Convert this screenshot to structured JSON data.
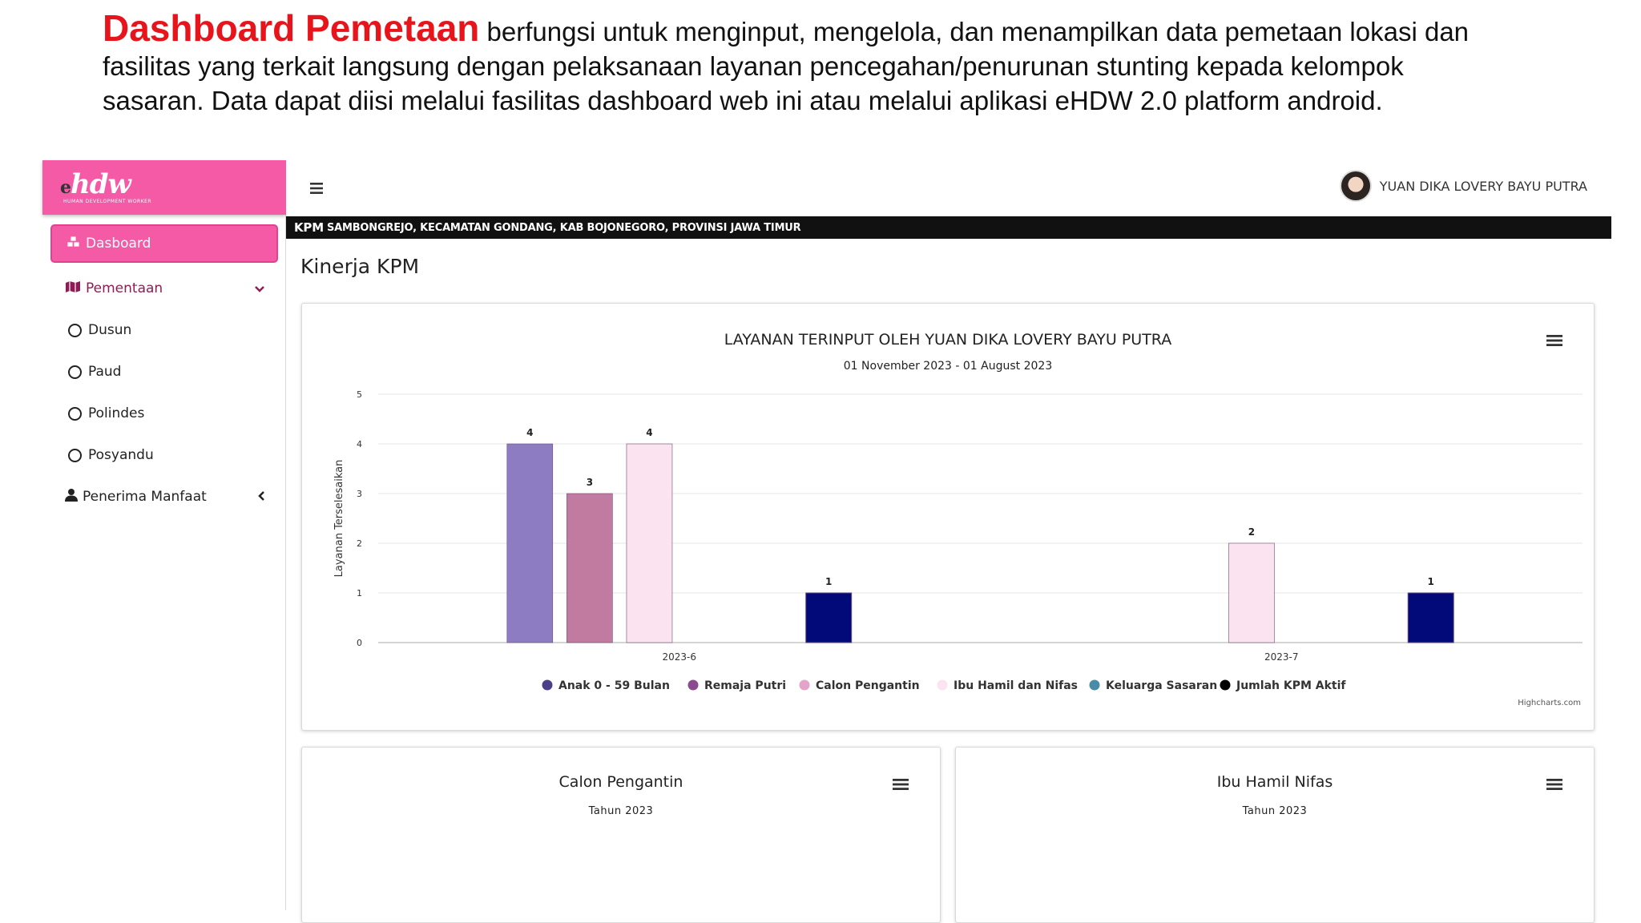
{
  "intro": {
    "highlight": "Dashboard Pemetaan",
    "line1": " berfungsi untuk menginput, mengelola, dan menampilkan data pemetaan lokasi dan",
    "line2": "fasilitas yang terkait langsung dengan pelaksanaan layanan pencegahan/penurunan stunting kepada kelompok",
    "line3": "sasaran. Data dapat diisi melalui fasilitas dashboard web ini atau melalui aplikasi eHDW 2.0 platform android."
  },
  "brand": {
    "logo_e": "e",
    "logo": "hdw",
    "tagline": "HUMAN DEVELOPMENT WORKER"
  },
  "sidebar": {
    "active": {
      "label": "Dasboard",
      "icon": "cubes-icon"
    },
    "items": [
      {
        "label": "Pementaan",
        "icon": "map-icon",
        "caret": "chevron-down-icon"
      },
      {
        "label": "Dusun",
        "icon": "circle-icon"
      },
      {
        "label": "Paud",
        "icon": "circle-icon"
      },
      {
        "label": "Polindes",
        "icon": "circle-icon"
      },
      {
        "label": "Posyandu",
        "icon": "circle-icon"
      },
      {
        "label": "Penerima Manfaat",
        "icon": "user-icon",
        "caret": "chevron-left-icon"
      }
    ]
  },
  "header": {
    "menu_icon": "hamburger-icon",
    "user_name": "YUAN DIKA LOVERY BAYU PUTRA"
  },
  "location": {
    "prefix": "KPM",
    "text": "SAMBONGREJO, KECAMATAN GONDANG, KAB BOJONEGORO, PROVINSI JAWA TIMUR"
  },
  "page": {
    "title": "Kinerja KPM"
  },
  "colors": {
    "brand": "#f45aa6",
    "anak": "#8e7cc3",
    "remaja": "#c27ba0",
    "calon": "#fbe0ee",
    "ibu": "#fde9f2",
    "keluarga": "#4a8ba6",
    "kpm": "#020a7a"
  },
  "chart_data": {
    "type": "bar",
    "title": "LAYANAN TERINPUT OLEH YUAN DIKA LOVERY BAYU PUTRA",
    "subtitle": "01 November 2023 - 01 August 2023",
    "ylabel": "Layanan Terselesaikan",
    "xlabel": "",
    "ylim": [
      0,
      5
    ],
    "yticks": [
      0,
      1,
      2,
      3,
      4,
      5
    ],
    "grid": true,
    "legend": "bottom",
    "categories": [
      "2023-6",
      "2023-7"
    ],
    "series": [
      {
        "name": "Anak 0 - 59 Bulan",
        "values": [
          4,
          0
        ],
        "color": "#8e7cc3",
        "legend_color": "#4b3f8a"
      },
      {
        "name": "Remaja Putri",
        "values": [
          3,
          0
        ],
        "color": "#c27ba0",
        "legend_color": "#8a4c8e"
      },
      {
        "name": "Calon Pengantin",
        "values": [
          4,
          2
        ],
        "color": "#fbe3ef",
        "legend_color": "#e4a3c8"
      },
      {
        "name": "Ibu Hamil dan Nifas",
        "values": [
          0,
          0
        ],
        "color": "#fdeef5",
        "legend_color": "#fbe3ef"
      },
      {
        "name": "Keluarga Sasaran",
        "values": [
          0,
          0
        ],
        "color": "#4a8ba6",
        "legend_color": "#4a8ba6"
      },
      {
        "name": "Jumlah KPM Aktif",
        "values": [
          1,
          1
        ],
        "color": "#020a7a",
        "legend_color": "#000000"
      }
    ],
    "credits": "Highcharts.com"
  },
  "cards": [
    {
      "title": "Calon Pengantin",
      "subtitle": "Tahun 2023"
    },
    {
      "title": "Ibu Hamil Nifas",
      "subtitle": "Tahun 2023"
    }
  ]
}
